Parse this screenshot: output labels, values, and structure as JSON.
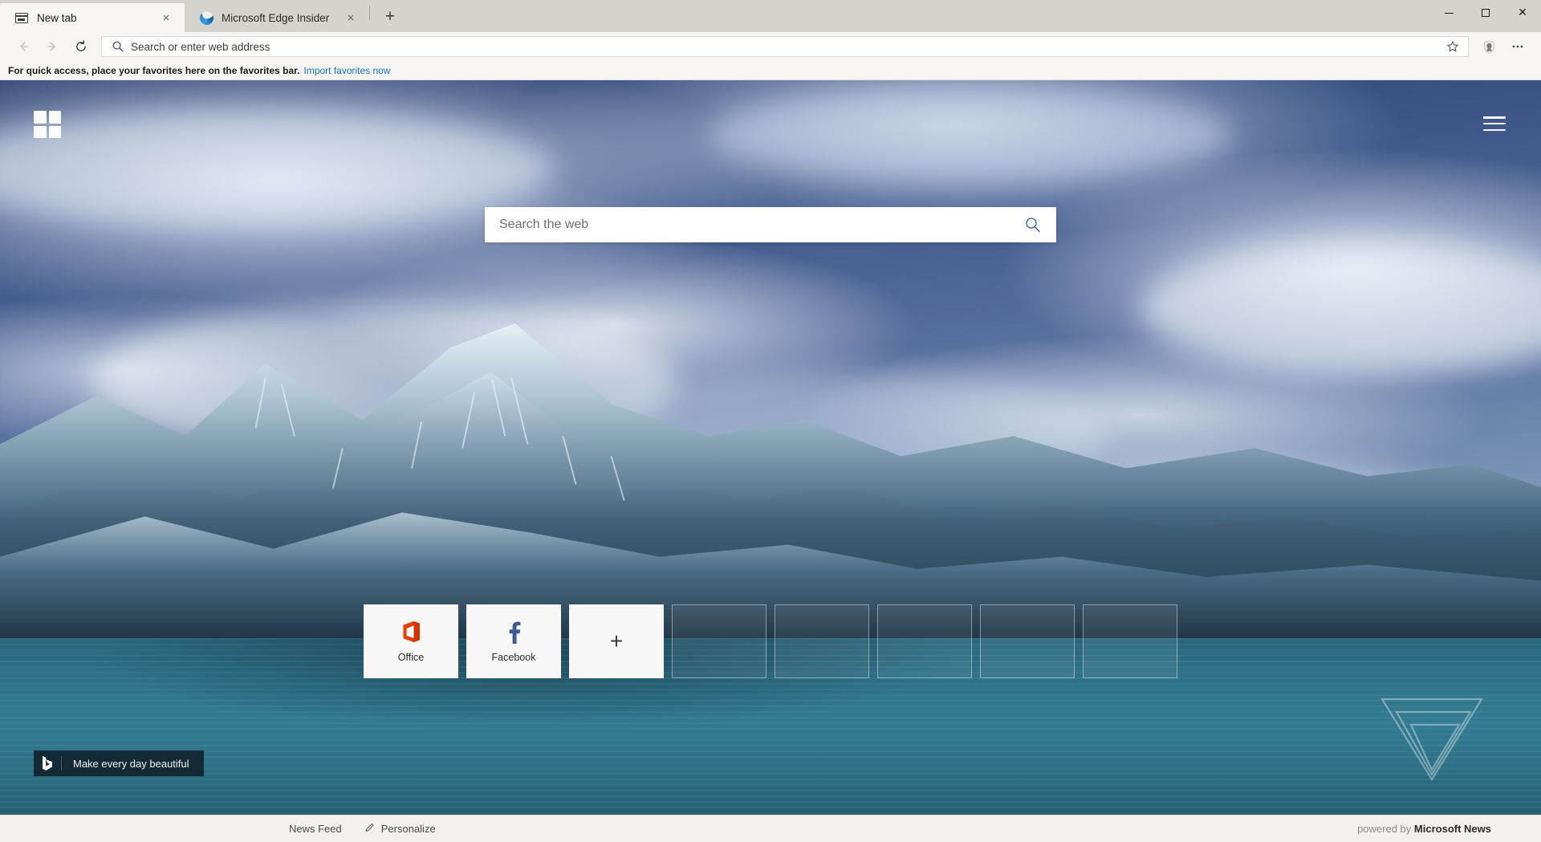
{
  "browser": {
    "tabs": [
      {
        "title": "New tab",
        "favicon": "newtab-icon",
        "active": true,
        "close_label": "×"
      },
      {
        "title": "Microsoft Edge Insider",
        "favicon": "edge-logo-icon",
        "active": false,
        "close_label": "×"
      }
    ],
    "new_tab_button": "+",
    "window_controls": {
      "minimize": "–",
      "maximize": "□",
      "close": "×"
    },
    "toolbar": {
      "back": "back-arrow-icon",
      "forward": "forward-arrow-icon",
      "refresh": "refresh-icon",
      "address_placeholder": "Search or enter web address",
      "address_value": "",
      "search_icon": "search-icon",
      "favorite_icon": "star-icon",
      "extension_icon": "shield-icon",
      "settings_icon": "more-ellipsis-icon"
    },
    "favorites_bar": {
      "message": "For quick access, place your favorites here on the favorites bar.",
      "import_link": "Import favorites now"
    }
  },
  "newtab": {
    "grid_button": "app-grid-icon",
    "menu_button": "hamburger-menu-icon",
    "search": {
      "placeholder": "Search the web",
      "value": "",
      "icon": "magnifier-icon"
    },
    "tiles": [
      {
        "label": "Office",
        "icon": "office-icon",
        "type": "site",
        "color": "#d83b01"
      },
      {
        "label": "Facebook",
        "icon": "facebook-icon",
        "type": "site",
        "color": "#3b5998"
      },
      {
        "label": "",
        "icon": "plus-icon",
        "type": "add"
      },
      {
        "label": "",
        "icon": "",
        "type": "empty"
      },
      {
        "label": "",
        "icon": "",
        "type": "empty"
      },
      {
        "label": "",
        "icon": "",
        "type": "empty"
      },
      {
        "label": "",
        "icon": "",
        "type": "empty"
      },
      {
        "label": "",
        "icon": "",
        "type": "empty"
      }
    ],
    "bing_badge": {
      "logo": "bing-logo-icon",
      "text": "Make every day beautiful"
    },
    "watermark": "the-verge-logo-icon",
    "background_description": "snow-capped-mountain-lake-photo"
  },
  "bottom_bar": {
    "news_feed": "News Feed",
    "personalize": "Personalize",
    "personalize_icon": "pencil-icon",
    "powered_by_prefix": "powered by",
    "powered_by_brand": "Microsoft News"
  },
  "colors": {
    "chrome_bg": "#f7f5f3",
    "tabbar_bg": "#d6d2ce",
    "link": "#1273c4",
    "office_orange": "#d83b01",
    "facebook_blue": "#3b5998",
    "lake_teal": "#327b93",
    "sky_blue": "#3b5486"
  }
}
